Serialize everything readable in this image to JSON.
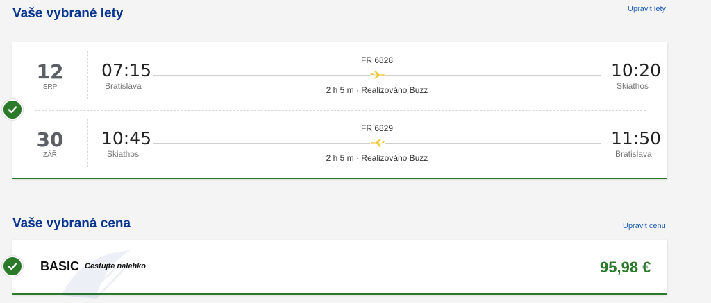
{
  "flights_section": {
    "title": "Vaše vybrané lety",
    "edit_label": "Upravit lety"
  },
  "flights": [
    {
      "day": "12",
      "month": "SRP",
      "depart_time": "07:15",
      "depart_city": "Bratislava",
      "flight_number": "FR 6828",
      "duration_operator": "2 h 5 m · Realizováno Buzz",
      "arrive_time": "10:20",
      "arrive_city": "Skiathos"
    },
    {
      "day": "30",
      "month": "ZÁŘ",
      "depart_time": "10:45",
      "depart_city": "Skiathos",
      "flight_number": "FR 6829",
      "duration_operator": "2 h 5 m · Realizováno Buzz",
      "arrive_time": "11:50",
      "arrive_city": "Bratislava"
    }
  ],
  "fare_section": {
    "title": "Vaše vybraná cena",
    "edit_label": "Upravit cenu",
    "fare_name": "BASIC",
    "fare_tagline": "Cestujte nalehko",
    "price": "95,98 €"
  },
  "colors": {
    "title": "#073590",
    "link": "#1f5fb4",
    "success": "#2a7a2a",
    "plane": "#f1c933"
  },
  "icons": {
    "check": "check-icon",
    "plane": "plane-icon"
  }
}
